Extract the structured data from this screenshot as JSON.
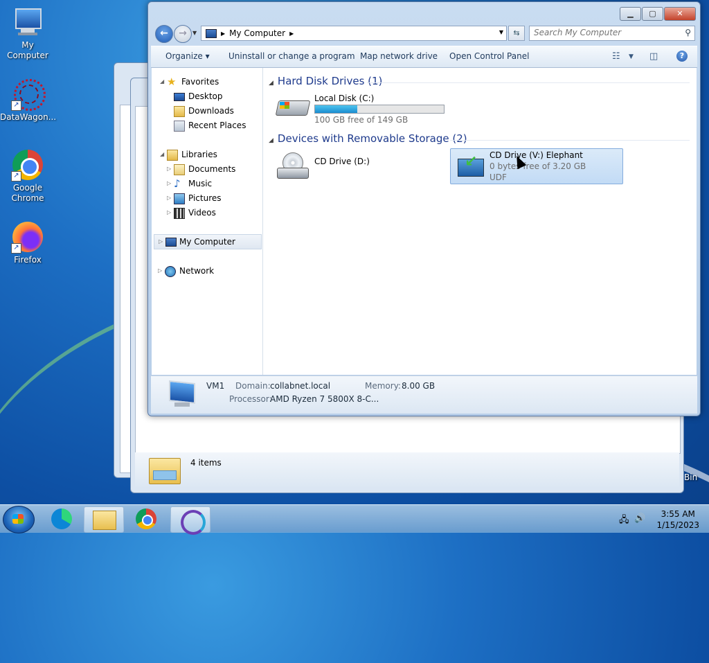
{
  "desktop": {
    "icons": [
      {
        "label": "My Computer"
      },
      {
        "label": "DataWagon..."
      },
      {
        "label": "Google Chrome"
      },
      {
        "label": "Firefox"
      }
    ],
    "recycle_fragment": "Bin"
  },
  "background_window": {
    "status": "4 items"
  },
  "explorer": {
    "address": {
      "crumb": "My Computer"
    },
    "search_placeholder": "Search My Computer",
    "toolbar": {
      "organize": "Organize",
      "uninstall": "Uninstall or change a program",
      "map_drive": "Map network drive",
      "control_panel": "Open Control Panel"
    },
    "nav": {
      "favorites": "Favorites",
      "desktop": "Desktop",
      "downloads": "Downloads",
      "recent": "Recent Places",
      "libraries": "Libraries",
      "documents": "Documents",
      "music": "Music",
      "pictures": "Pictures",
      "videos": "Videos",
      "computer": "My Computer",
      "network": "Network"
    },
    "groups": {
      "hdd": "Hard Disk Drives (1)",
      "removable": "Devices with Removable Storage (2)"
    },
    "drives": {
      "c": {
        "name": "Local Disk (C:)",
        "free": "100 GB free of 149 GB",
        "used_fraction": 0.33
      },
      "d": {
        "name": "CD Drive (D:)"
      },
      "v": {
        "name": "CD Drive (V:) Elephant",
        "free": "0 bytes free of 3.20 GB",
        "fs": "UDF"
      }
    },
    "details": {
      "computer_name": "VM1",
      "domain_label": "Domain:",
      "domain": "collabnet.local",
      "memory_label": "Memory:",
      "memory": "8.00 GB",
      "processor_label": "Processor:",
      "processor": "AMD Ryzen 7 5800X 8-C..."
    }
  },
  "taskbar": {
    "time": "3:55 AM",
    "date": "1/15/2023"
  },
  "colors": {
    "accent": "#1e3a8c",
    "selection": "#c2dbf5",
    "progress": "#1b8ed1"
  }
}
